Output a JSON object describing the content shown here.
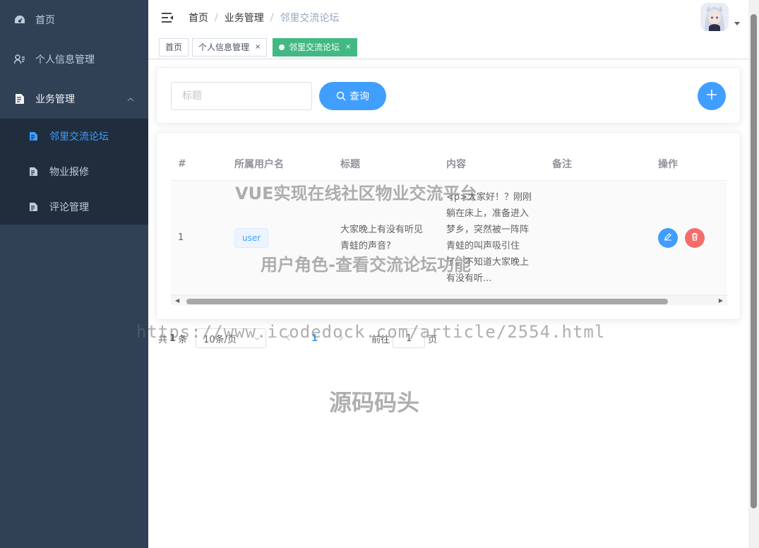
{
  "sidebar": {
    "items": [
      {
        "label": "首页",
        "icon": "dashboard-icon"
      },
      {
        "label": "个人信息管理",
        "icon": "user-info-icon"
      },
      {
        "label": "业务管理",
        "icon": "business-icon"
      }
    ],
    "subitems": [
      {
        "label": "邻里交流论坛",
        "icon": "document-icon",
        "active": true
      },
      {
        "label": "物业报修",
        "icon": "document-icon"
      },
      {
        "label": "评论管理",
        "icon": "document-icon"
      }
    ]
  },
  "breadcrumb": [
    "首页",
    "业务管理",
    "邻里交流论坛"
  ],
  "breadcrumb_sep": "/",
  "tags": [
    {
      "label": "首页"
    },
    {
      "label": "个人信息管理",
      "close": "×"
    },
    {
      "label": "邻里交流论坛",
      "close": "×",
      "active": true
    }
  ],
  "search": {
    "placeholder": "标题",
    "button_label": "查询"
  },
  "table": {
    "headers": [
      "#",
      "所属用户名",
      "标题",
      "内容",
      "备注",
      "操作"
    ],
    "rows": [
      {
        "index": "1",
        "user": "user",
        "title_lines": [
          "大家晚上有没有听见",
          "青蛙的声音?"
        ],
        "content_lines": [
          "<p>大家好！？刚刚",
          "躺在床上，准备进入",
          "梦乡，突然被一阵阵",
          "青蛙的叫声吸引住",
          "了。不知道大家晚上",
          "有没有听..."
        ],
        "remark": ""
      }
    ]
  },
  "pagination": {
    "total_prefix": "共",
    "total": "1",
    "total_suffix": "条",
    "page_size": "10条/页",
    "current_page": "1",
    "goto_prefix": "前往",
    "goto_value": "1",
    "goto_suffix": "页"
  },
  "watermarks": {
    "line1": "VUE实现在线社区物业交流平台",
    "line2": "用户角色-查看交流论坛功能",
    "url": "https://www.icodedock.com/article/2554.html",
    "brand": "源码码头"
  },
  "colors": {
    "sidebar_bg": "#304156",
    "primary": "#409EFF",
    "danger": "#F56C6C",
    "tag_active": "#42b983"
  }
}
